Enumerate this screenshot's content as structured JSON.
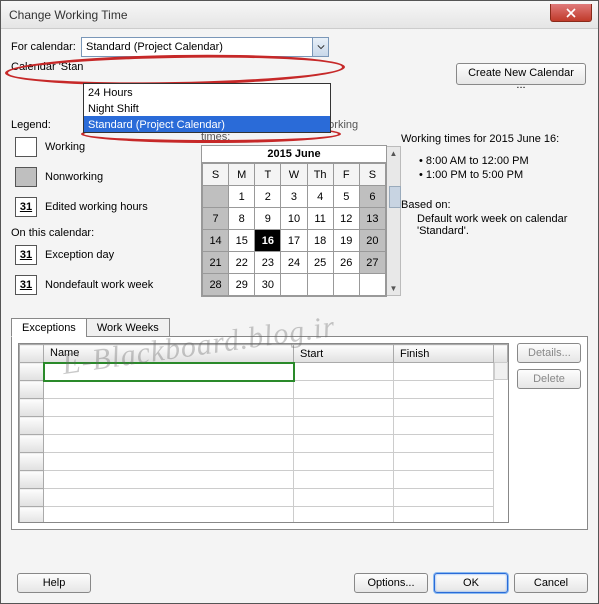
{
  "title": "Change Working Time",
  "for_label": "For calendar:",
  "combo_value": "Standard (Project Calendar)",
  "combo_options": [
    "24 Hours",
    "Night Shift",
    "Standard (Project Calendar)"
  ],
  "calendar_line": "Calendar 'Stan",
  "create_btn": "Create New Calendar ...",
  "legend_label": "Legend:",
  "legend": {
    "working": "Working",
    "nonworking": "Nonworking",
    "edited": "Edited working hours",
    "edited_num": "31"
  },
  "on_this_cal": "On this calendar:",
  "exception_day": "Exception day",
  "exception_num": "31",
  "nondefault": "Nondefault work week",
  "nondefault_num": "31",
  "click_text": "Click on a day to see its working times:",
  "cal_title": "2015 June",
  "dow": [
    "S",
    "M",
    "T",
    "W",
    "Th",
    "F",
    "S"
  ],
  "cal_rows": [
    [
      "",
      "1",
      "2",
      "3",
      "4",
      "5",
      "6"
    ],
    [
      "7",
      "8",
      "9",
      "10",
      "11",
      "12",
      "13"
    ],
    [
      "14",
      "15",
      "16",
      "17",
      "18",
      "19",
      "20"
    ],
    [
      "21",
      "22",
      "23",
      "24",
      "25",
      "26",
      "27"
    ],
    [
      "28",
      "29",
      "30",
      "",
      "",
      "",
      ""
    ]
  ],
  "working_times_header": "Working times for 2015 June 16:",
  "working_times": [
    "8:00 AM to 12:00 PM",
    "1:00 PM to 5:00 PM"
  ],
  "based_on_label": "Based on:",
  "based_on_text": "Default work week on calendar 'Standard'.",
  "tabs": {
    "exceptions": "Exceptions",
    "workweeks": "Work Weeks"
  },
  "grid_headers": {
    "name": "Name",
    "start": "Start",
    "finish": "Finish"
  },
  "details_btn": "Details...",
  "delete_btn": "Delete",
  "help_btn": "Help",
  "options_btn": "Options...",
  "ok_btn": "OK",
  "cancel_btn": "Cancel",
  "watermark": "E-Blackboard.blog.ir"
}
